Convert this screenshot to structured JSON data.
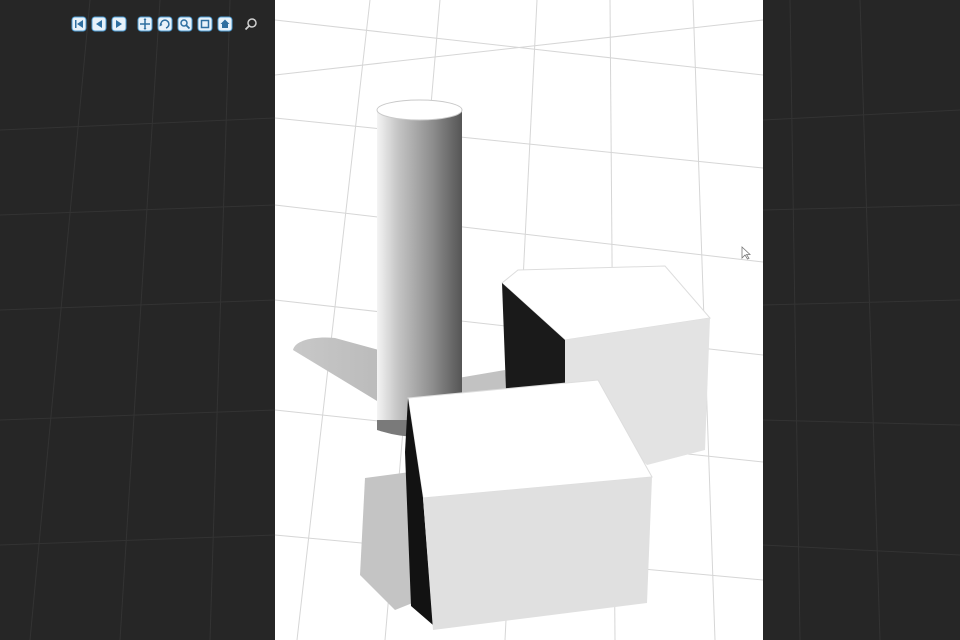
{
  "app": {
    "view": "3d-viewport",
    "theme": {
      "background": "#262626",
      "viewport": "#ffffff",
      "grid_dark": "#333333",
      "grid_light": "#d4d4d4",
      "tool_accent": "#4f9fd6"
    }
  },
  "toolbar": {
    "tools": [
      {
        "name": "first-frame-tool",
        "icon": "first-frame-icon"
      },
      {
        "name": "previous-frame-tool",
        "icon": "previous-frame-icon"
      },
      {
        "name": "next-frame-tool",
        "icon": "next-frame-icon"
      },
      {
        "name": "pan-tool",
        "icon": "pan-icon"
      },
      {
        "name": "rotate-tool",
        "icon": "rotate-icon"
      },
      {
        "name": "zoom-tool",
        "icon": "zoom-icon"
      },
      {
        "name": "fit-view-tool",
        "icon": "fit-view-icon"
      },
      {
        "name": "home-view-tool",
        "icon": "home-view-icon"
      },
      {
        "name": "inspect-tool",
        "icon": "inspect-icon"
      }
    ]
  },
  "scene": {
    "objects": [
      {
        "name": "cylinder",
        "shape": "cylinder"
      },
      {
        "name": "back-box",
        "shape": "box"
      },
      {
        "name": "front-box",
        "shape": "box"
      }
    ]
  }
}
